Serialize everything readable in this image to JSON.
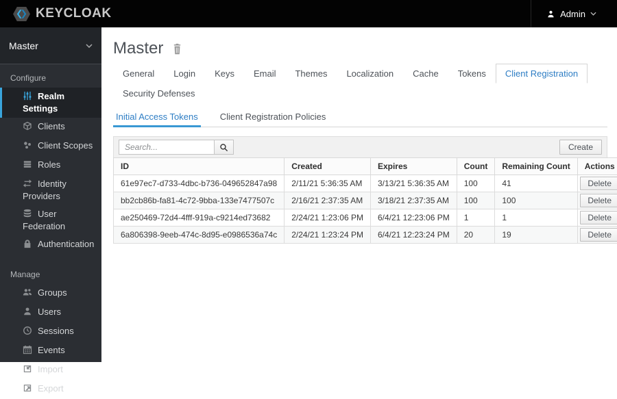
{
  "topbar": {
    "brand": "KEYCLOAK",
    "user_menu": {
      "label": "Admin"
    }
  },
  "sidebar": {
    "realm_selector": {
      "label": "Master"
    },
    "sections": [
      {
        "label": "Configure",
        "items": [
          {
            "label": "Realm Settings",
            "icon": "sliders-icon",
            "active": true
          },
          {
            "label": "Clients",
            "icon": "cube-icon",
            "active": false
          },
          {
            "label": "Client Scopes",
            "icon": "scopes-icon",
            "active": false
          },
          {
            "label": "Roles",
            "icon": "list-icon",
            "active": false
          },
          {
            "label": "Identity Providers",
            "icon": "arrows-swap-icon",
            "active": false
          },
          {
            "label": "User Federation",
            "icon": "database-icon",
            "active": false
          },
          {
            "label": "Authentication",
            "icon": "lock-icon",
            "active": false
          }
        ]
      },
      {
        "label": "Manage",
        "items": [
          {
            "label": "Groups",
            "icon": "groups-icon",
            "active": false
          },
          {
            "label": "Users",
            "icon": "user-icon",
            "active": false
          },
          {
            "label": "Sessions",
            "icon": "clock-icon",
            "active": false
          },
          {
            "label": "Events",
            "icon": "calendar-icon",
            "active": false
          },
          {
            "label": "Import",
            "icon": "import-icon",
            "active": false
          },
          {
            "label": "Export",
            "icon": "export-icon",
            "active": false
          }
        ]
      }
    ]
  },
  "main": {
    "title": "Master",
    "tabs": [
      "General",
      "Login",
      "Keys",
      "Email",
      "Themes",
      "Localization",
      "Cache",
      "Tokens",
      "Client Registration",
      "Security Defenses"
    ],
    "active_tab": "Client Registration",
    "subtabs": [
      "Initial Access Tokens",
      "Client Registration Policies"
    ],
    "active_subtab": "Initial Access Tokens",
    "toolbar": {
      "search_placeholder": "Search...",
      "create_label": "Create"
    },
    "table": {
      "columns": [
        "ID",
        "Created",
        "Expires",
        "Count",
        "Remaining Count",
        "Actions"
      ],
      "rows": [
        {
          "id": "61e97ec7-d733-4dbc-b736-049652847a98",
          "created": "2/11/21 5:36:35 AM",
          "expires": "3/13/21 5:36:35 AM",
          "count": "100",
          "remaining_count": "41",
          "action": "Delete"
        },
        {
          "id": "bb2cb86b-fa81-4c72-9bba-133e7477507c",
          "created": "2/16/21 2:37:35 AM",
          "expires": "3/18/21 2:37:35 AM",
          "count": "100",
          "remaining_count": "100",
          "action": "Delete"
        },
        {
          "id": "ae250469-72d4-4fff-919a-c9214ed73682",
          "created": "2/24/21 1:23:06 PM",
          "expires": "6/4/21 12:23:06 PM",
          "count": "1",
          "remaining_count": "1",
          "action": "Delete"
        },
        {
          "id": "6a806398-9eeb-474c-8d95-e0986536a74c",
          "created": "2/24/21 1:23:24 PM",
          "expires": "6/4/21 12:23:24 PM",
          "count": "20",
          "remaining_count": "19",
          "action": "Delete"
        }
      ]
    }
  },
  "colors": {
    "topbar_bg": "#030303",
    "sidebar_bg": "#2b2e33",
    "accent_blue": "#2d7dc4",
    "subtab_underline": "#3998d3",
    "sidebar_active_border": "#39a5dc"
  }
}
